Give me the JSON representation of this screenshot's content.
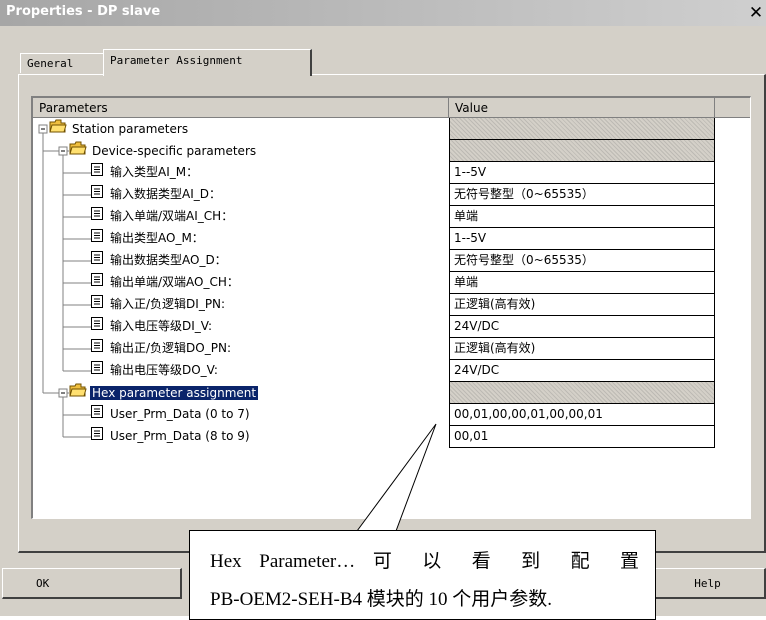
{
  "window": {
    "title": "Properties - DP slave"
  },
  "tabs": [
    {
      "label": "General",
      "active": false
    },
    {
      "label": "Parameter Assignment",
      "active": true
    }
  ],
  "table": {
    "headers": {
      "parameters": "Parameters",
      "value": "Value"
    },
    "rows": [
      {
        "label": "Station parameters",
        "value": "",
        "kind": "folder",
        "level": 0,
        "expanded": true,
        "selected": false
      },
      {
        "label": "Device-specific parameters",
        "value": "",
        "kind": "folder",
        "level": 1,
        "expanded": true,
        "selected": false
      },
      {
        "label": "输入类型AI_M：",
        "value": "1--5V",
        "kind": "item",
        "level": 2,
        "selected": false
      },
      {
        "label": "输入数据类型AI_D：",
        "value": "无符号整型（0~65535）",
        "kind": "item",
        "level": 2,
        "selected": false
      },
      {
        "label": "输入单端/双端AI_CH：",
        "value": "单端",
        "kind": "item",
        "level": 2,
        "selected": false
      },
      {
        "label": "输出类型AO_M：",
        "value": "1--5V",
        "kind": "item",
        "level": 2,
        "selected": false
      },
      {
        "label": "输出数据类型AO_D：",
        "value": "无符号整型（0~65535）",
        "kind": "item",
        "level": 2,
        "selected": false
      },
      {
        "label": "输出单端/双端AO_CH：",
        "value": "单端",
        "kind": "item",
        "level": 2,
        "selected": false
      },
      {
        "label": "输入正/负逻辑DI_PN:",
        "value": "正逻辑(高有效)",
        "kind": "item",
        "level": 2,
        "selected": false
      },
      {
        "label": "输入电压等级DI_V:",
        "value": "24V/DC",
        "kind": "item",
        "level": 2,
        "selected": false
      },
      {
        "label": "输出正/负逻辑DO_PN:",
        "value": "正逻辑(高有效)",
        "kind": "item",
        "level": 2,
        "selected": false
      },
      {
        "label": "输出电压等级DO_V:",
        "value": "24V/DC",
        "kind": "item",
        "level": 2,
        "selected": false
      },
      {
        "label": "Hex parameter assignment",
        "value": "",
        "kind": "folder",
        "level": 1,
        "expanded": true,
        "selected": true
      },
      {
        "label": "User_Prm_Data (0 to 7)",
        "value": "00,01,00,00,01,00,00,01",
        "kind": "item",
        "level": 2,
        "selected": false
      },
      {
        "label": "User_Prm_Data (8 to 9)",
        "value": "00,01",
        "kind": "item",
        "level": 2,
        "selected": false
      }
    ]
  },
  "buttons": {
    "ok": "OK",
    "help": "Help"
  },
  "callout": {
    "line1_parts": [
      "Hex",
      "Parameter…",
      "可",
      "以",
      "看",
      "到",
      "配",
      "置"
    ],
    "line2": "PB-OEM2-SEH-B4 模块的 10 个用户参数."
  },
  "colors": {
    "selection": "#0a246a",
    "face": "#d4d0c8",
    "folder": "#f0c040"
  },
  "icons": {
    "close": "close-icon",
    "folder": "folder-open-icon",
    "item": "parameter-item-icon",
    "expander": "minus-box-icon"
  }
}
